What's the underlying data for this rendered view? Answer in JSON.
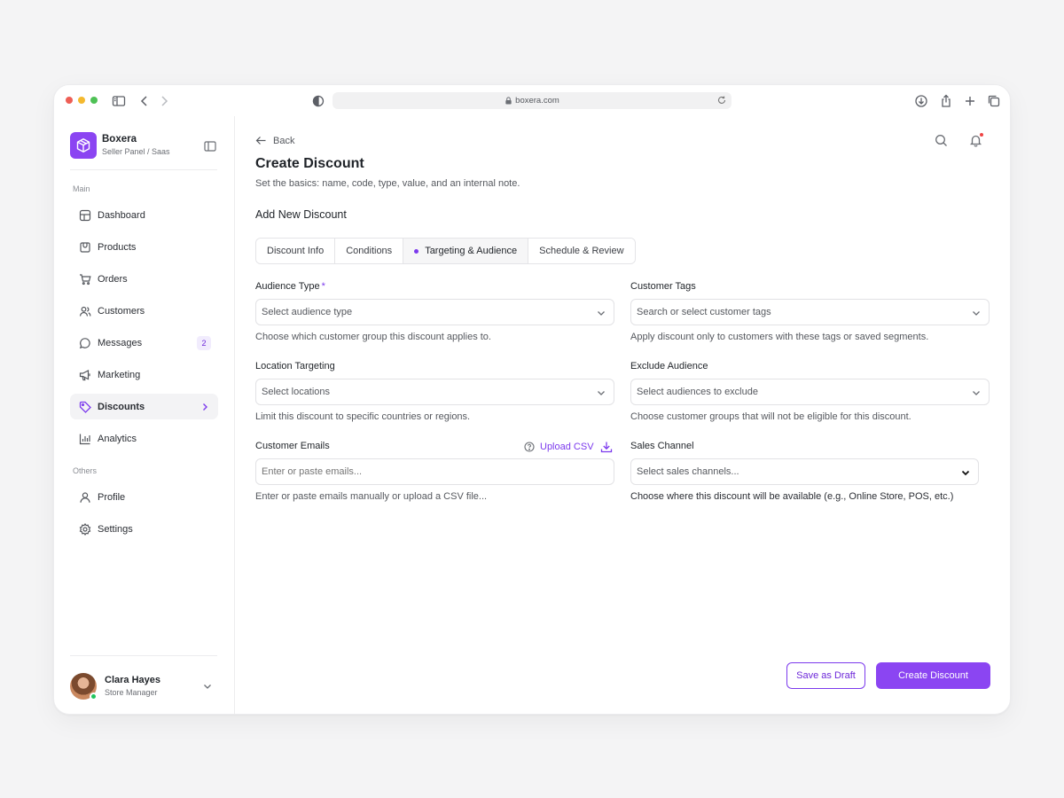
{
  "browser": {
    "url": "boxera.com"
  },
  "brand": {
    "name": "Boxera",
    "subtitle": "Seller Panel / Saas"
  },
  "sidebar": {
    "main_section_label": "Main",
    "others_section_label": "Others",
    "items": [
      {
        "label": "Dashboard",
        "icon": "grid-icon"
      },
      {
        "label": "Products",
        "icon": "box-icon"
      },
      {
        "label": "Orders",
        "icon": "cart-icon"
      },
      {
        "label": "Customers",
        "icon": "users-icon"
      },
      {
        "label": "Messages",
        "icon": "message-icon",
        "badge": "2"
      },
      {
        "label": "Marketing",
        "icon": "megaphone-icon"
      },
      {
        "label": "Discounts",
        "icon": "tag-icon",
        "active": true
      },
      {
        "label": "Analytics",
        "icon": "bar-chart-icon"
      }
    ],
    "others": [
      {
        "label": "Profile",
        "icon": "user-icon"
      },
      {
        "label": "Settings",
        "icon": "gear-icon"
      }
    ]
  },
  "user": {
    "name": "Clara Hayes",
    "role": "Store Manager"
  },
  "header": {
    "back_label": "Back",
    "title": "Create Discount",
    "subtitle": "Set the basics: name, code, type, value, and an internal note."
  },
  "form": {
    "section_title": "Add New Discount",
    "tabs": [
      "Discount Info",
      "Conditions",
      "Targeting & Audience",
      "Schedule & Review"
    ],
    "active_tab": "Targeting & Audience",
    "fields": {
      "audience_type": {
        "label": "Audience Type",
        "required_mark": "*",
        "placeholder": "Select audience type",
        "helper": "Choose which customer group this discount applies to."
      },
      "customer_tags": {
        "label": "Customer Tags",
        "placeholder": "Search or select customer tags",
        "helper": "Apply discount only to customers with these tags or saved segments."
      },
      "location_targeting": {
        "label": "Location Targeting",
        "placeholder": "Select locations",
        "helper": "Limit this discount to specific countries or regions."
      },
      "exclude_audience": {
        "label": "Exclude Audience",
        "placeholder": "Select audiences to exclude",
        "helper": "Choose customer groups that will not be eligible for this discount."
      },
      "customer_emails": {
        "label": "Customer Emails",
        "upload_label": "Upload CSV",
        "placeholder": "Enter or paste emails...",
        "helper": "Enter or paste emails manually or upload a CSV file..."
      },
      "sales_channel": {
        "label": "Sales Channel",
        "placeholder": "Select sales channels...",
        "helper": "Choose where this discount will be available (e.g., Online Store, POS, etc.)"
      }
    }
  },
  "actions": {
    "draft_label": "Save as Draft",
    "create_label": "Create Discount"
  },
  "colors": {
    "accent": "#8b45f2",
    "active_nav_bg": "#f3f3f5",
    "online": "#22c55e",
    "notification": "#ef4444"
  }
}
